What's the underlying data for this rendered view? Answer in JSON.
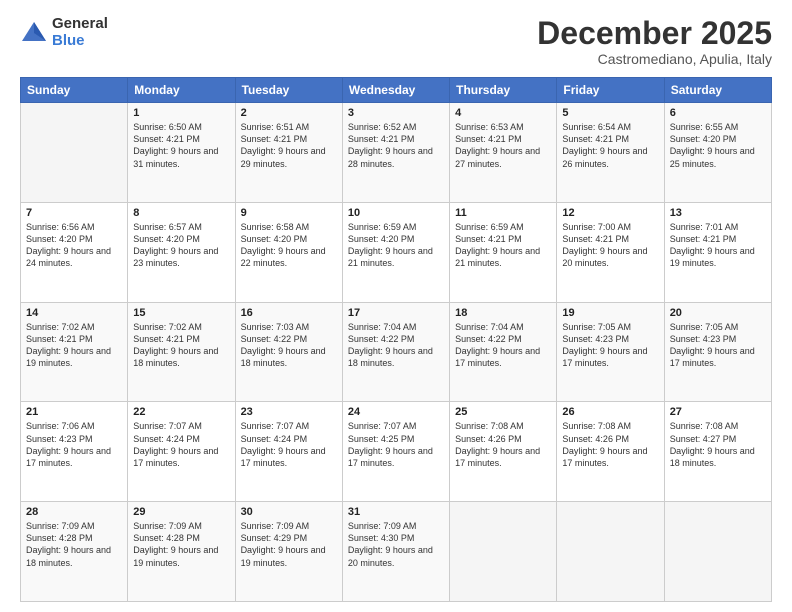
{
  "logo": {
    "general": "General",
    "blue": "Blue"
  },
  "title": {
    "month": "December 2025",
    "location": "Castromediano, Apulia, Italy"
  },
  "weekdays": [
    "Sunday",
    "Monday",
    "Tuesday",
    "Wednesday",
    "Thursday",
    "Friday",
    "Saturday"
  ],
  "weeks": [
    [
      {
        "day": "",
        "sunrise": "",
        "sunset": "",
        "daylight": ""
      },
      {
        "day": "1",
        "sunrise": "Sunrise: 6:50 AM",
        "sunset": "Sunset: 4:21 PM",
        "daylight": "Daylight: 9 hours and 31 minutes."
      },
      {
        "day": "2",
        "sunrise": "Sunrise: 6:51 AM",
        "sunset": "Sunset: 4:21 PM",
        "daylight": "Daylight: 9 hours and 29 minutes."
      },
      {
        "day": "3",
        "sunrise": "Sunrise: 6:52 AM",
        "sunset": "Sunset: 4:21 PM",
        "daylight": "Daylight: 9 hours and 28 minutes."
      },
      {
        "day": "4",
        "sunrise": "Sunrise: 6:53 AM",
        "sunset": "Sunset: 4:21 PM",
        "daylight": "Daylight: 9 hours and 27 minutes."
      },
      {
        "day": "5",
        "sunrise": "Sunrise: 6:54 AM",
        "sunset": "Sunset: 4:21 PM",
        "daylight": "Daylight: 9 hours and 26 minutes."
      },
      {
        "day": "6",
        "sunrise": "Sunrise: 6:55 AM",
        "sunset": "Sunset: 4:20 PM",
        "daylight": "Daylight: 9 hours and 25 minutes."
      }
    ],
    [
      {
        "day": "7",
        "sunrise": "Sunrise: 6:56 AM",
        "sunset": "Sunset: 4:20 PM",
        "daylight": "Daylight: 9 hours and 24 minutes."
      },
      {
        "day": "8",
        "sunrise": "Sunrise: 6:57 AM",
        "sunset": "Sunset: 4:20 PM",
        "daylight": "Daylight: 9 hours and 23 minutes."
      },
      {
        "day": "9",
        "sunrise": "Sunrise: 6:58 AM",
        "sunset": "Sunset: 4:20 PM",
        "daylight": "Daylight: 9 hours and 22 minutes."
      },
      {
        "day": "10",
        "sunrise": "Sunrise: 6:59 AM",
        "sunset": "Sunset: 4:20 PM",
        "daylight": "Daylight: 9 hours and 21 minutes."
      },
      {
        "day": "11",
        "sunrise": "Sunrise: 6:59 AM",
        "sunset": "Sunset: 4:21 PM",
        "daylight": "Daylight: 9 hours and 21 minutes."
      },
      {
        "day": "12",
        "sunrise": "Sunrise: 7:00 AM",
        "sunset": "Sunset: 4:21 PM",
        "daylight": "Daylight: 9 hours and 20 minutes."
      },
      {
        "day": "13",
        "sunrise": "Sunrise: 7:01 AM",
        "sunset": "Sunset: 4:21 PM",
        "daylight": "Daylight: 9 hours and 19 minutes."
      }
    ],
    [
      {
        "day": "14",
        "sunrise": "Sunrise: 7:02 AM",
        "sunset": "Sunset: 4:21 PM",
        "daylight": "Daylight: 9 hours and 19 minutes."
      },
      {
        "day": "15",
        "sunrise": "Sunrise: 7:02 AM",
        "sunset": "Sunset: 4:21 PM",
        "daylight": "Daylight: 9 hours and 18 minutes."
      },
      {
        "day": "16",
        "sunrise": "Sunrise: 7:03 AM",
        "sunset": "Sunset: 4:22 PM",
        "daylight": "Daylight: 9 hours and 18 minutes."
      },
      {
        "day": "17",
        "sunrise": "Sunrise: 7:04 AM",
        "sunset": "Sunset: 4:22 PM",
        "daylight": "Daylight: 9 hours and 18 minutes."
      },
      {
        "day": "18",
        "sunrise": "Sunrise: 7:04 AM",
        "sunset": "Sunset: 4:22 PM",
        "daylight": "Daylight: 9 hours and 17 minutes."
      },
      {
        "day": "19",
        "sunrise": "Sunrise: 7:05 AM",
        "sunset": "Sunset: 4:23 PM",
        "daylight": "Daylight: 9 hours and 17 minutes."
      },
      {
        "day": "20",
        "sunrise": "Sunrise: 7:05 AM",
        "sunset": "Sunset: 4:23 PM",
        "daylight": "Daylight: 9 hours and 17 minutes."
      }
    ],
    [
      {
        "day": "21",
        "sunrise": "Sunrise: 7:06 AM",
        "sunset": "Sunset: 4:23 PM",
        "daylight": "Daylight: 9 hours and 17 minutes."
      },
      {
        "day": "22",
        "sunrise": "Sunrise: 7:07 AM",
        "sunset": "Sunset: 4:24 PM",
        "daylight": "Daylight: 9 hours and 17 minutes."
      },
      {
        "day": "23",
        "sunrise": "Sunrise: 7:07 AM",
        "sunset": "Sunset: 4:24 PM",
        "daylight": "Daylight: 9 hours and 17 minutes."
      },
      {
        "day": "24",
        "sunrise": "Sunrise: 7:07 AM",
        "sunset": "Sunset: 4:25 PM",
        "daylight": "Daylight: 9 hours and 17 minutes."
      },
      {
        "day": "25",
        "sunrise": "Sunrise: 7:08 AM",
        "sunset": "Sunset: 4:26 PM",
        "daylight": "Daylight: 9 hours and 17 minutes."
      },
      {
        "day": "26",
        "sunrise": "Sunrise: 7:08 AM",
        "sunset": "Sunset: 4:26 PM",
        "daylight": "Daylight: 9 hours and 17 minutes."
      },
      {
        "day": "27",
        "sunrise": "Sunrise: 7:08 AM",
        "sunset": "Sunset: 4:27 PM",
        "daylight": "Daylight: 9 hours and 18 minutes."
      }
    ],
    [
      {
        "day": "28",
        "sunrise": "Sunrise: 7:09 AM",
        "sunset": "Sunset: 4:28 PM",
        "daylight": "Daylight: 9 hours and 18 minutes."
      },
      {
        "day": "29",
        "sunrise": "Sunrise: 7:09 AM",
        "sunset": "Sunset: 4:28 PM",
        "daylight": "Daylight: 9 hours and 19 minutes."
      },
      {
        "day": "30",
        "sunrise": "Sunrise: 7:09 AM",
        "sunset": "Sunset: 4:29 PM",
        "daylight": "Daylight: 9 hours and 19 minutes."
      },
      {
        "day": "31",
        "sunrise": "Sunrise: 7:09 AM",
        "sunset": "Sunset: 4:30 PM",
        "daylight": "Daylight: 9 hours and 20 minutes."
      },
      {
        "day": "",
        "sunrise": "",
        "sunset": "",
        "daylight": ""
      },
      {
        "day": "",
        "sunrise": "",
        "sunset": "",
        "daylight": ""
      },
      {
        "day": "",
        "sunrise": "",
        "sunset": "",
        "daylight": ""
      }
    ]
  ]
}
